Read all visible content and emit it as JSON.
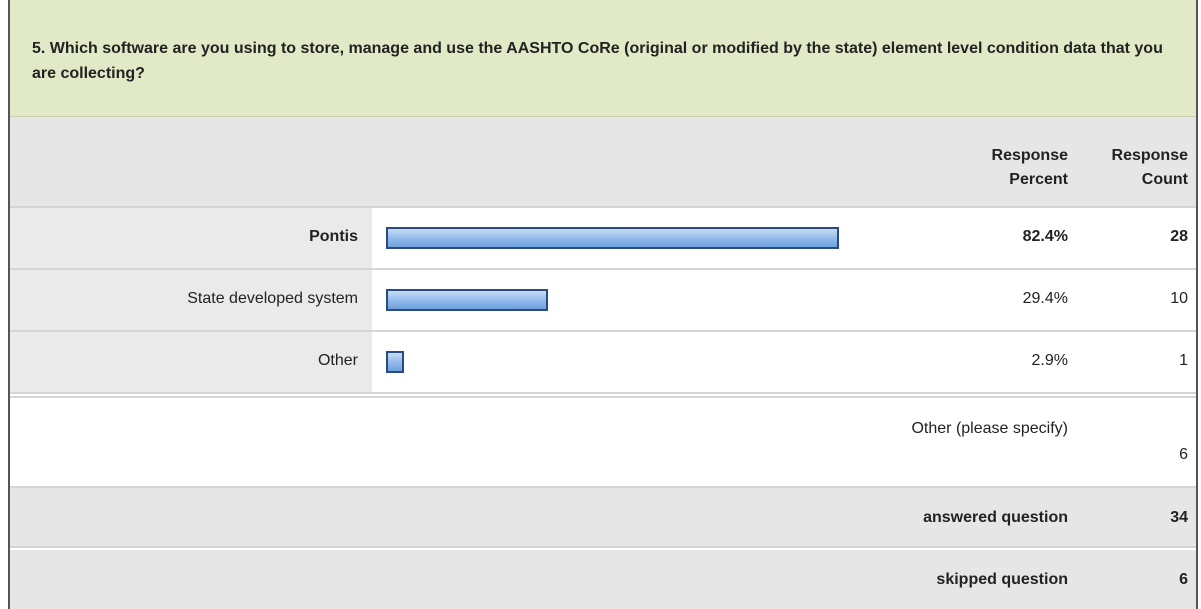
{
  "question": "5. Which software are you using to store, manage and use the AASHTO CoRe (original or modified by the state) element level condition data that you are collecting?",
  "header": {
    "percent_label_1": "Response",
    "percent_label_2": "Percent",
    "count_label_1": "Response",
    "count_label_2": "Count"
  },
  "chart_data": {
    "type": "bar",
    "orientation": "horizontal",
    "categories": [
      "Pontis",
      "State developed system",
      "Other"
    ],
    "values": [
      82.4,
      29.4,
      2.9
    ],
    "percent_labels": [
      "82.4%",
      "29.4%",
      "2.9%"
    ],
    "counts": [
      "28",
      "10",
      "1"
    ],
    "xlim": [
      0,
      100
    ],
    "grid": false,
    "bar_color": "#8fb8ea",
    "bar_border_color": "#2b4a7e",
    "highlight_category": "Pontis"
  },
  "other_specify": {
    "label": "Other (please specify)",
    "count": "6"
  },
  "summary": {
    "answered_label": "answered question",
    "answered_count": "34",
    "skipped_label": "skipped question",
    "skipped_count": "6"
  },
  "colors": {
    "question_bg": "#e2e9c6",
    "header_bg": "#e6e6e6"
  }
}
